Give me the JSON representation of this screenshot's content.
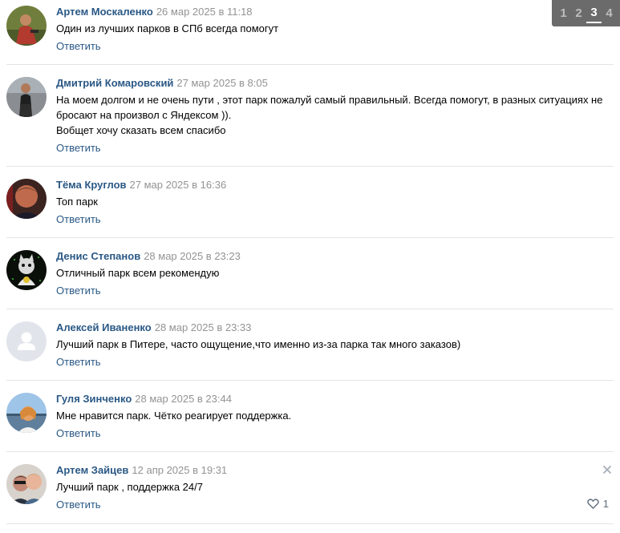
{
  "pager": {
    "pages": [
      "1",
      "2",
      "3",
      "4"
    ],
    "current": "3"
  },
  "colors": {
    "author": "#2a5885",
    "date": "#939393",
    "divider": "#e2e4e8",
    "pager_bg": "#6b6b6b"
  },
  "reply_label": "Ответить",
  "comments": [
    {
      "author": "Артем Москаленко",
      "date": "26 мар 2025 в 11:18",
      "lines": [
        "Один из лучших парков в СПб всегда помогут"
      ],
      "avatar": "avatar-photo-moskalenko"
    },
    {
      "author": "Дмитрий Комаровский",
      "date": "27 мар 2025 в 8:05",
      "lines": [
        "На моем долгом и не очень пути , этот парк пожалуй самый правильный. Всегда помогут, в разных ситуациях не бросают на произвол с Яндексом )).",
        "Вобщет хочу сказать всем спасибо"
      ],
      "avatar": "avatar-photo-komarovsky"
    },
    {
      "author": "Тёма Круглов",
      "date": "27 мар 2025 в 16:36",
      "lines": [
        "Топ парк"
      ],
      "avatar": "avatar-photo-kruglov"
    },
    {
      "author": "Денис Степанов",
      "date": "28 мар 2025 в 23:23",
      "lines": [
        "Отличный парк всем рекомендую"
      ],
      "avatar": "avatar-photo-stepanov"
    },
    {
      "author": "Алексей Иваненко",
      "date": "28 мар 2025 в 23:33",
      "lines": [
        "Лучший парк в Питере, часто ощущение,что именно из-за парка так много заказов)"
      ],
      "avatar": "default-avatar-icon"
    },
    {
      "author": "Гуля Зинченко",
      "date": "28 мар 2025 в 23:44",
      "lines": [
        "Мне нравится парк. Чётко реагирует поддержка."
      ],
      "avatar": "avatar-photo-zinchenko"
    },
    {
      "author": "Артем Зайцев",
      "date": "12 апр 2025 в 19:31",
      "lines": [
        "Лучший парк , поддержка 24/7"
      ],
      "avatar": "avatar-photo-zaitsev",
      "likes": "1",
      "has_close": true
    }
  ]
}
